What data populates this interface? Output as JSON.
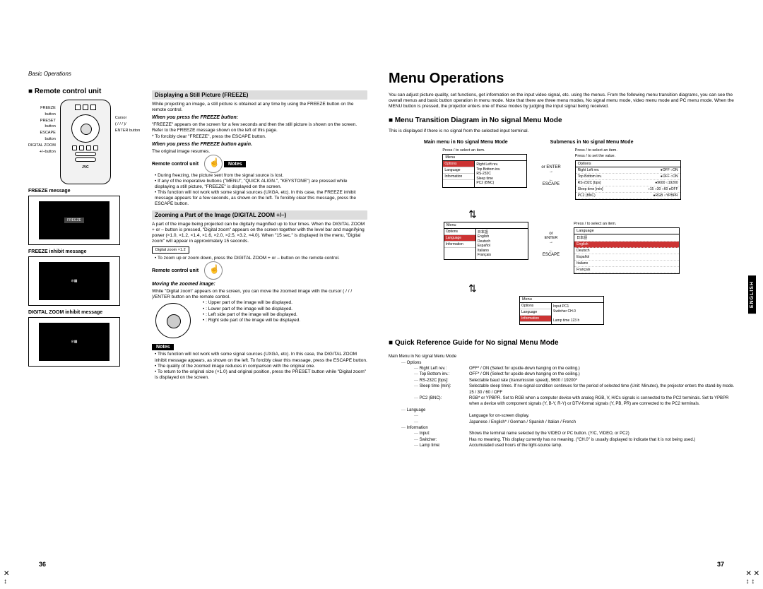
{
  "left": {
    "header": "Basic Operations",
    "h2a": "Remote control unit",
    "remote_labels_left": "FREEZE\nbutton\nPRESET\nbutton\nESCAPE\nbutton\nDIGITAL ZOOM\n+/–button",
    "remote_labels_right": "Cursor\n( / / / )/\nENTER button",
    "brand": "JVC",
    "freeze_msg": "FREEZE message",
    "freeze_chip": "FREEZE",
    "inhibit_msg": "FREEZE inhibit message",
    "dz_inhibit": "DIGITAL ZOOM inhibit message",
    "h3a": "Displaying a Still Picture (FREEZE)",
    "p1": "While projecting an image, a still picture is obtained at any time by using the FREEZE button on the remote control.",
    "ital1": "When you press the FREEZE button:",
    "p2": "\"FREEZE\" appears on the screen for a few seconds and then the still picture is shown on the screen. Refer to the FREEZE message shown on the left of this page.\n* To forcibly clear \"FREEZE\", press the ESCAPE button.",
    "ital2": "When you press the FREEZE button again.",
    "p3": "The original image resumes.",
    "rcu_label": "Remote control unit",
    "notes1": [
      "During freezing, the picture sent from the signal source is lost.",
      "If any of the inoperative buttons (\"MENU\", \"QUICK ALIGN.\", \"KEYSTONE\") are pressed while displaying a still picture, \"FREEZE\" is displayed on the screen.",
      "This function will not work with some signal sources (UXGA, etc). In this case, the FREEZE inhibit message appears for a few seconds, as shown on the left. To forcibly clear this message, press the ESCAPE button."
    ],
    "h3b": "Zooming a Part of the Image (DIGITAL ZOOM +/–)",
    "p4": "A part of the image being projected can be digitally magnified up to four times. When the DIGITAL ZOOM + or – button is pressed, \"Digital zoom\" appears on the screen together with the level bar and magnifying power (×1.0, ×1.2, ×1.4, ×1.6, ×2.0, ×2.5, ×3.2, ×4.0). When \"15 sec.\" is displayed in the menu, \"Digital zoom\" will appear in approximately 15 seconds.",
    "dz_bar": "Digital zoom   ×1.2",
    "p5": "To zoom up or zoom down, press the DIGITAL ZOOM + or – button on the remote control.",
    "ital3": "Moving the zoomed image:",
    "p6": "While \"Digital zoom\" appears on the screen, you can move the zoomed image with the cursor ( / / / )/ENTER button on the remote control.",
    "move_list": [
      ": Upper part of the image will be displayed.",
      ": Lower part of the image will be displayed.",
      ": Left side part of the image will be displayed.",
      ": Right side part of the image will be displayed."
    ],
    "notes2": [
      "This function will not work with some signal sources (UXGA, etc). In this case, the DIGITAL ZOOM inhibit message appears, as shown on the left. To forcibly clear this message, press the ESCAPE button.",
      "The quality of the zoomed image reduces in comparison with the original one.",
      "To return to the original size (×1.0) and original position, press the PRESET button while \"Digital zoom\" is displayed on the screen."
    ]
  },
  "right": {
    "h1": "Menu Operations",
    "intro": "You can adjust picture quality, set functions, get information on the input video signal, etc. using the menus. From the following menu transition diagrams, you can see the overall menus and basic button operation in menu mode. Note that there are three menu modes, No signal menu mode, video menu mode and PC menu mode. When the MENU button is pressed, the projector enters one of these modes by judging the input signal being received.",
    "h2a": "Menu Transition Diagram in No signal Menu Mode",
    "sub": "This is displayed if there is no signal from the selected input terminal.",
    "mainmenu_title": "Main menu in No signal Menu Mode",
    "submenu_title": "Submenus in No signal Menu Mode",
    "press_sel": "Press   /   to select an item.",
    "press_set": "Press   /   to set the value.",
    "or_enter": "or ENTER",
    "or": "or",
    "enter": "ENTER",
    "escape": "ESCAPE",
    "menus": {
      "box1": {
        "hdr": "Menu",
        "tabs": [
          "Options",
          "Language",
          "Information"
        ],
        "content": "Right Left rev.\nTop Bottom inv.\nRS-232C\nSleep time\nPC2 (BNC)"
      },
      "box2": {
        "hdr": "Menu",
        "tabs": [
          "Options",
          "Language",
          "Information"
        ],
        "content": "日本語\nEnglish\nDeutsch\nEspañol\nItaliano\nFrançais"
      },
      "box3": {
        "hdr": "Menu",
        "tabs": [
          "Options",
          "Language",
          "Information"
        ],
        "content": "Input          PC1\nSwitcher      CH.0\n\nLamp time     123 h"
      },
      "sub1": {
        "hdr": "Options",
        "rows": [
          [
            "Right Left rev.",
            "●OFF  ○ON"
          ],
          [
            "Top Bottom inv.",
            "●OFF  ○ON"
          ],
          [
            "RS-232C [bps]",
            "●9600  ○19200"
          ],
          [
            "Sleep time [min]",
            "○15 ○30 ○60 ●OFF"
          ],
          [
            "PC2 (BNC)",
            "●RGB  ○YPBPR"
          ]
        ]
      },
      "sub2": {
        "hdr": "Language",
        "rows": [
          [
            "日本語",
            ""
          ],
          [
            "English",
            ""
          ],
          [
            "Deutsch",
            ""
          ],
          [
            "Español",
            ""
          ],
          [
            "Italiano",
            ""
          ],
          [
            "Français",
            ""
          ]
        ]
      }
    },
    "h2b": "Quick Reference Guide for No signal Menu Mode",
    "qr_root": "Main Menu in No signal Menu Mode",
    "qr": [
      {
        "k": "Options",
        "children": [
          {
            "k": "Right Left rev.:",
            "v": "OFF* / ON (Select for upside-down hanging on the ceiling.)"
          },
          {
            "k": "Top Bottom inv.:",
            "v": "OFF* / ON (Select for upside-down hanging on the ceiling.)"
          },
          {
            "k": "RS-232C [bps]:",
            "v": "Selectable baud rate (transmission speed), 9600 / 19200*"
          },
          {
            "k": "Sleep time [min]:",
            "v": "Selectable sleep times. If no-signal condition continues for the period of selected time (Unit: Minutes), the projector enters the stand-by mode. 15 / 30 / 60 / OFF"
          },
          {
            "k": "PC2 (BNC):",
            "v": "RGB* or YPBPR. Set to RGB when a computer device with analog RGB, V, H/Cs signals is connected to the PC2 terminals. Set to YPBPR when a device with component signals (Y, B-Y, R-Y) or DTV-format signals (Y, PB, PR) are connected to the PC2 terminals."
          }
        ]
      },
      {
        "k": "Language",
        "children": [
          {
            "k": "",
            "v": "Language for on-screen display."
          },
          {
            "k": "",
            "v": "Japanese / English* / German / Spanish / Italian / French"
          }
        ]
      },
      {
        "k": "Information",
        "children": [
          {
            "k": "Input:",
            "v": "Shows the terminal name selected by the VIDEO or PC button. (Y/C, VIDEO, or PC2)"
          },
          {
            "k": "Switcher:",
            "v": "Has no meaning. This display currently has no meaning. (\"CH.0\" is usually displayed to indicate that it is not being used.)"
          },
          {
            "k": "Lamp time:",
            "v": "Accumulated used hours of the light-source lamp."
          }
        ]
      }
    ]
  },
  "pg_left": "36",
  "pg_right": "37",
  "lang_tab": "ENGLISH"
}
